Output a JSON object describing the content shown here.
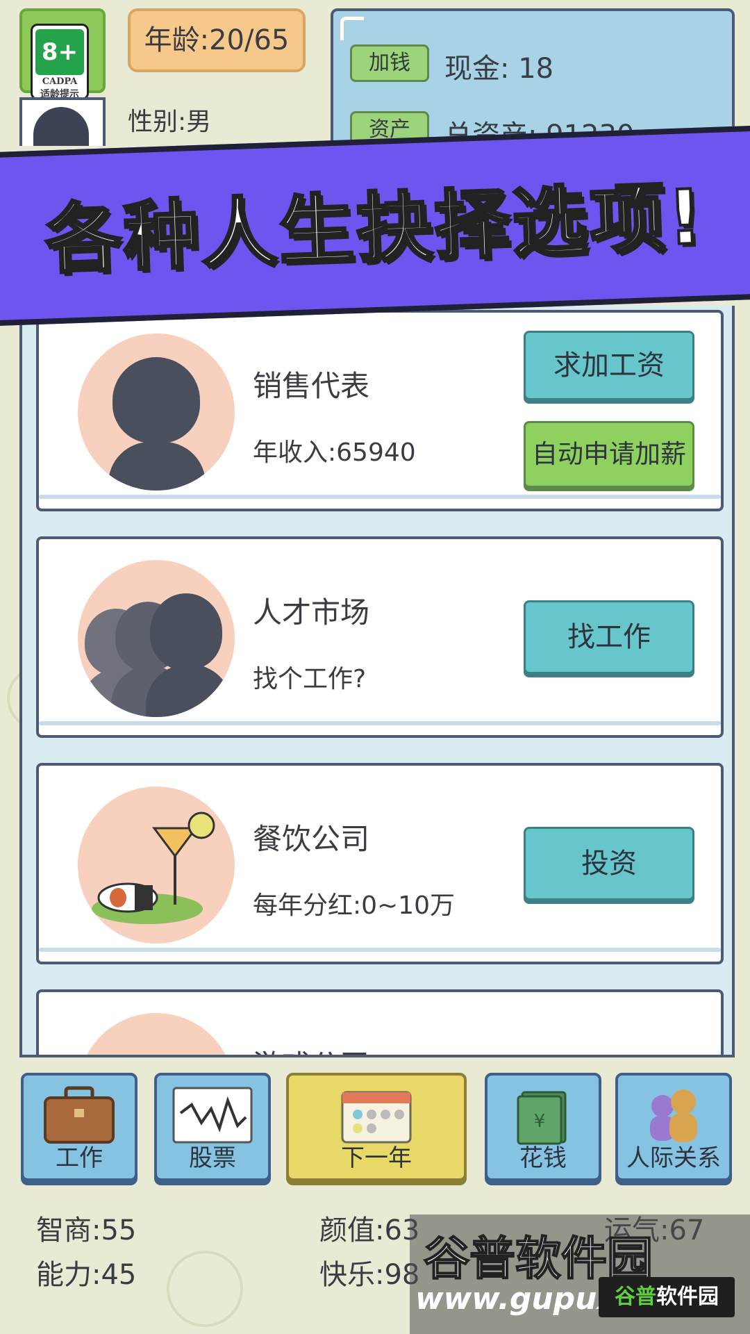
{
  "top": {
    "age_rating": {
      "badge": "8+",
      "org": "CADPA",
      "hint": "适龄提示"
    },
    "age": "年龄:20/65",
    "gender": "性别:男",
    "money_button": "加钱",
    "cash": "现金: 18",
    "asset_button": "资产",
    "total_assets": "总资产: 91230"
  },
  "banner": {
    "text": "各种人生抉择选项!"
  },
  "cards": [
    {
      "title": "销售代表",
      "subtitle": "年收入:65940",
      "buttons": [
        "求加工资",
        "自动申请加薪"
      ]
    },
    {
      "title": "人才市场",
      "subtitle": "找个工作?",
      "buttons": [
        "找工作"
      ]
    },
    {
      "title": "餐饮公司",
      "subtitle": "每年分红:0~10万",
      "buttons": [
        "投资"
      ]
    },
    {
      "title": "游戏公司"
    }
  ],
  "nav": [
    {
      "label": "工作",
      "icon": "briefcase-icon"
    },
    {
      "label": "股票",
      "icon": "stock-chart-icon"
    },
    {
      "label": "下一年",
      "icon": "calendar-icon",
      "active": true
    },
    {
      "label": "花钱",
      "icon": "money-bills-icon"
    },
    {
      "label": "人际关系",
      "icon": "people-icon"
    }
  ],
  "attributes": {
    "iq": "智商:55",
    "looks": "颜值:63",
    "luck": "运气:67",
    "ability": "能力:45",
    "happiness": "快乐:98"
  },
  "watermark": {
    "brand": "谷普软件园",
    "url": "www.gupux",
    "logo_a": "谷普",
    "logo_b": "软件园"
  },
  "colors": {
    "banner": "#6f55f0",
    "button_blue": "#67c5cc",
    "button_green": "#8ed15f",
    "nav_active": "#e7d867"
  }
}
